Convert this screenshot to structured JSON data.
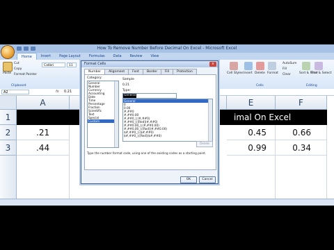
{
  "window": {
    "title": "How To Remove Number Before Decimal On Excel - Microsoft Excel"
  },
  "ribbon": {
    "tabs": [
      "Home",
      "Insert",
      "Page Layout",
      "Formulas",
      "Data",
      "Review",
      "View"
    ],
    "paste_label": "Paste",
    "cut_label": "Cut",
    "copy_label": "Copy",
    "format_painter_label": "Format Painter",
    "font_name": "Calibri",
    "font_size": "11",
    "clipboard_label": "Clipboard",
    "cell_styles_label": "Cell Styles",
    "insert_label": "Insert",
    "delete_label": "Delete",
    "format_label": "Format",
    "cells_label": "Cells",
    "autosum_label": "AutoSum",
    "fill_label": "Fill",
    "clear_label": "Clear",
    "sort_filter_label": "Sort & Filter",
    "find_select_label": "Find & Select",
    "editing_label": "Editing"
  },
  "formula_bar": {
    "name_box": "A2",
    "fx": "fx",
    "value": "0.21"
  },
  "sheet": {
    "columns": [
      "A",
      "E",
      "F"
    ],
    "rows": [
      "1",
      "2",
      "3"
    ],
    "header_text": "imal On Excel",
    "cells": {
      "A2": ".21",
      "A3": ".44",
      "E2": "0.45",
      "F2": "0.66",
      "E3": "0.99",
      "F3": "0.34"
    }
  },
  "dialog": {
    "title": "Format Cells",
    "close": "x",
    "tabs": [
      "Number",
      "Alignment",
      "Font",
      "Border",
      "Fill",
      "Protection"
    ],
    "category_label": "Category:",
    "categories": [
      "General",
      "Number",
      "Currency",
      "Accounting",
      "Date",
      "Time",
      "Percentage",
      "Fraction",
      "Scientific",
      "Text",
      "Special",
      "Custom"
    ],
    "selected_category": "Custom",
    "sample_label": "Sample",
    "sample_value": "0.21",
    "type_label": "Type:",
    "type_value": "General",
    "formats": [
      "General",
      "0",
      "0.00",
      "#,##0",
      "#,##0.00",
      "#,##0_);(#,##0)",
      "#,##0_);[Red](#,##0)",
      "#,##0.00_);(#,##0.00)",
      "#,##0.00_);[Red](#,##0.00)",
      "$#,##0_);($#,##0)",
      "$#,##0_);[Red]($#,##0)"
    ],
    "delete_label": "Delete",
    "hint": "Type the number format code, using one of the existing codes as a starting point.",
    "ok_label": "OK",
    "cancel_label": "Cancel"
  }
}
